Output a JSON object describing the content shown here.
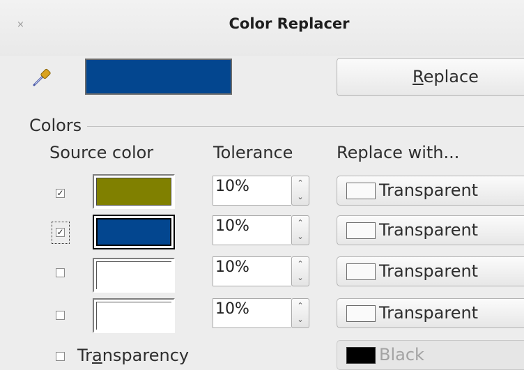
{
  "window": {
    "title": "Color Replacer",
    "close_glyph": "×"
  },
  "pipette": {
    "icon": "pipette-icon",
    "preview_color": "#03468f"
  },
  "replace_button": {
    "label_prefix": "R",
    "label_rest": "eplace"
  },
  "colors_section": {
    "label": "Colors",
    "headers": {
      "source": "Source color",
      "tolerance": "Tolerance",
      "replace": "Replace with..."
    },
    "rows": [
      {
        "checked": true,
        "check_glyph": "✓",
        "source_color": "#808000",
        "tolerance": "10%",
        "replace_label": "Transparent"
      },
      {
        "checked": true,
        "check_glyph": "✓",
        "source_color": "#03468f",
        "tolerance": "10%",
        "replace_label": "Transparent",
        "focused": true
      },
      {
        "checked": false,
        "check_glyph": "",
        "source_color": "#ffffff",
        "tolerance": "10%",
        "replace_label": "Transparent"
      },
      {
        "checked": false,
        "check_glyph": "",
        "source_color": "#ffffff",
        "tolerance": "10%",
        "replace_label": "Transparent"
      }
    ]
  },
  "transparency": {
    "label_prefix": "Tr",
    "label_mnemonic": "a",
    "label_rest": "nsparency",
    "checked": false,
    "replace_label": "Black",
    "replace_color": "#000000"
  },
  "spin_glyphs": {
    "up": "⌃",
    "down": "⌄"
  }
}
